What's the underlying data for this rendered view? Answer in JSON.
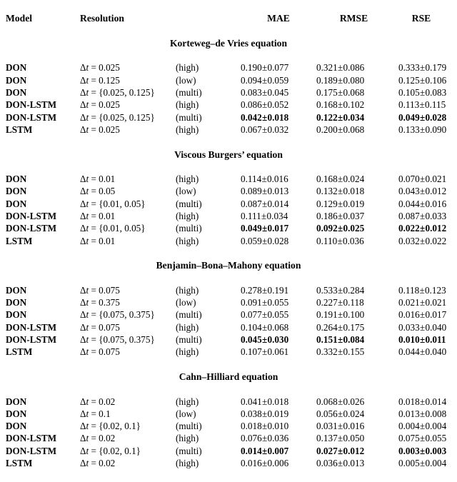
{
  "table": {
    "columns": [
      {
        "key": "model",
        "label": "Model"
      },
      {
        "key": "resolution",
        "label": "Resolution"
      },
      {
        "key": "resolution_label",
        "label": ""
      },
      {
        "key": "mae",
        "label": "MAE"
      },
      {
        "key": "rmse",
        "label": "RMSE"
      },
      {
        "key": "rse",
        "label": "RSE"
      }
    ],
    "sections": [
      {
        "title": "Korteweg–de Vries equation",
        "rows": [
          {
            "model": "DON",
            "dt": "Δt = 0.025",
            "res_label": "(high)",
            "mae": "0.190±0.077",
            "rmse": "0.321±0.086",
            "rse": "0.333±0.179",
            "best": false
          },
          {
            "model": "DON",
            "dt": "Δt = 0.125",
            "res_label": "(low)",
            "mae": "0.094±0.059",
            "rmse": "0.189±0.080",
            "rse": "0.125±0.106",
            "best": false
          },
          {
            "model": "DON",
            "dt": "Δt = {0.025, 0.125}",
            "res_label": "(multi)",
            "mae": "0.083±0.045",
            "rmse": "0.175±0.068",
            "rse": "0.105±0.083",
            "best": false
          },
          {
            "model": "DON-LSTM",
            "dt": "Δt = 0.025",
            "res_label": "(high)",
            "mae": "0.086±0.052",
            "rmse": "0.168±0.102",
            "rse": "0.113±0.115",
            "best": false
          },
          {
            "model": "DON-LSTM",
            "dt": "Δt = {0.025, 0.125}",
            "res_label": "(multi)",
            "mae": "0.042±0.018",
            "rmse": "0.122±0.034",
            "rse": "0.049±0.028",
            "best": true
          },
          {
            "model": "LSTM",
            "dt": "Δt = 0.025",
            "res_label": "(high)",
            "mae": "0.067±0.032",
            "rmse": "0.200±0.068",
            "rse": "0.133±0.090",
            "best": false
          }
        ]
      },
      {
        "title": "Viscous Burgers’ equation",
        "rows": [
          {
            "model": "DON",
            "dt": "Δt = 0.01",
            "res_label": "(high)",
            "mae": "0.114±0.016",
            "rmse": "0.168±0.024",
            "rse": "0.070±0.021",
            "best": false
          },
          {
            "model": "DON",
            "dt": "Δt = 0.05",
            "res_label": "(low)",
            "mae": "0.089±0.013",
            "rmse": "0.132±0.018",
            "rse": "0.043±0.012",
            "best": false
          },
          {
            "model": "DON",
            "dt": "Δt = {0.01, 0.05}",
            "res_label": "(multi)",
            "mae": "0.087±0.014",
            "rmse": "0.129±0.019",
            "rse": "0.044±0.016",
            "best": false
          },
          {
            "model": "DON-LSTM",
            "dt": "Δt = 0.01",
            "res_label": "(high)",
            "mae": "0.111±0.034",
            "rmse": "0.186±0.037",
            "rse": "0.087±0.033",
            "best": false
          },
          {
            "model": "DON-LSTM",
            "dt": "Δt = {0.01, 0.05}",
            "res_label": "(multi)",
            "mae": "0.049±0.017",
            "rmse": "0.092±0.025",
            "rse": "0.022±0.012",
            "best": true
          },
          {
            "model": "LSTM",
            "dt": "Δt = 0.01",
            "res_label": "(high)",
            "mae": "0.059±0.028",
            "rmse": "0.110±0.036",
            "rse": "0.032±0.022",
            "best": false
          }
        ]
      },
      {
        "title": "Benjamin–Bona–Mahony equation",
        "rows": [
          {
            "model": "DON",
            "dt": "Δt = 0.075",
            "res_label": "(high)",
            "mae": "0.278±0.191",
            "rmse": "0.533±0.284",
            "rse": "0.118±0.123",
            "best": false
          },
          {
            "model": "DON",
            "dt": "Δt = 0.375",
            "res_label": "(low)",
            "mae": "0.091±0.055",
            "rmse": "0.227±0.118",
            "rse": "0.021±0.021",
            "best": false
          },
          {
            "model": "DON",
            "dt": "Δt = {0.075, 0.375}",
            "res_label": "(multi)",
            "mae": "0.077±0.055",
            "rmse": "0.191±0.100",
            "rse": "0.016±0.017",
            "best": false
          },
          {
            "model": "DON-LSTM",
            "dt": "Δt = 0.075",
            "res_label": "(high)",
            "mae": "0.104±0.068",
            "rmse": "0.264±0.175",
            "rse": "0.033±0.040",
            "best": false
          },
          {
            "model": "DON-LSTM",
            "dt": "Δt = {0.075, 0.375}",
            "res_label": "(multi)",
            "mae": "0.045±0.030",
            "rmse": "0.151±0.084",
            "rse": "0.010±0.011",
            "best": true
          },
          {
            "model": "LSTM",
            "dt": "Δt = 0.075",
            "res_label": "(high)",
            "mae": "0.107±0.061",
            "rmse": "0.332±0.155",
            "rse": "0.044±0.040",
            "best": false
          }
        ]
      },
      {
        "title": "Cahn–Hilliard equation",
        "rows": [
          {
            "model": "DON",
            "dt": "Δt = 0.02",
            "res_label": "(high)",
            "mae": "0.041±0.018",
            "rmse": "0.068±0.026",
            "rse": "0.018±0.014",
            "best": false
          },
          {
            "model": "DON",
            "dt": "Δt = 0.1",
            "res_label": "(low)",
            "mae": "0.038±0.019",
            "rmse": "0.056±0.024",
            "rse": "0.013±0.008",
            "best": false
          },
          {
            "model": "DON",
            "dt": "Δt = {0.02, 0.1}",
            "res_label": "(multi)",
            "mae": "0.018±0.010",
            "rmse": "0.031±0.016",
            "rse": "0.004±0.004",
            "best": false
          },
          {
            "model": "DON-LSTM",
            "dt": "Δt = 0.02",
            "res_label": "(high)",
            "mae": "0.076±0.036",
            "rmse": "0.137±0.050",
            "rse": "0.075±0.055",
            "best": false
          },
          {
            "model": "DON-LSTM",
            "dt": "Δt = {0.02, 0.1}",
            "res_label": "(multi)",
            "mae": "0.014±0.007",
            "rmse": "0.027±0.012",
            "rse": "0.003±0.003",
            "best": true
          },
          {
            "model": "LSTM",
            "dt": "Δt = 0.02",
            "res_label": "(high)",
            "mae": "0.016±0.006",
            "rmse": "0.036±0.013",
            "rse": "0.005±0.004",
            "best": false
          }
        ]
      }
    ]
  }
}
